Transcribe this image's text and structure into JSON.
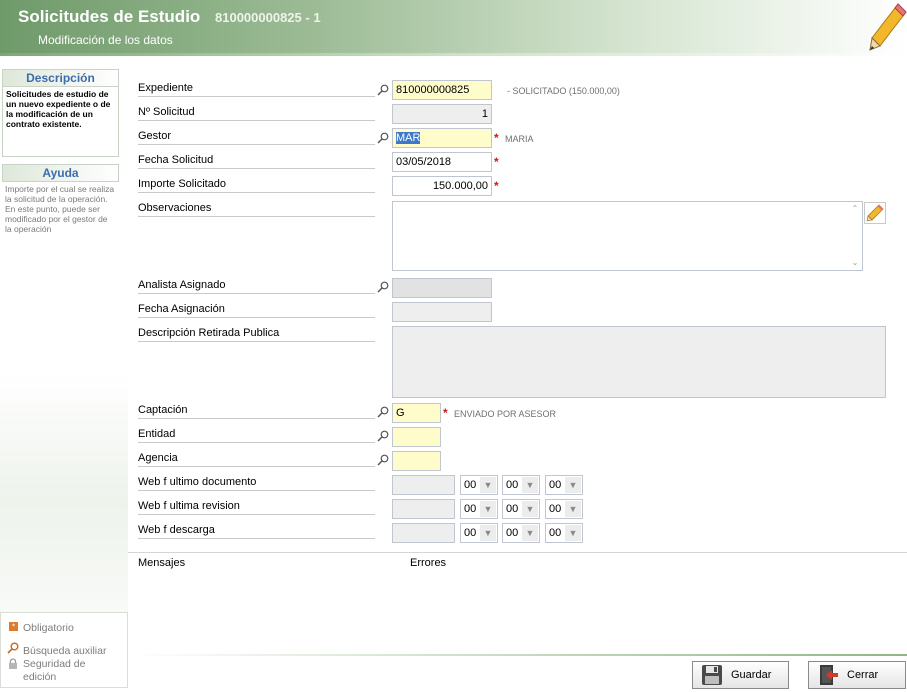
{
  "header": {
    "title": "Solicitudes de Estudio",
    "record_id": "810000000825 - 1",
    "subtitle": "Modificación de los datos"
  },
  "sidebar": {
    "description_title": "Descripción",
    "description_text": "Solicitudes de estudio de un nuevo expediente o de la modificación de un contrato existente.",
    "help_title": "Ayuda",
    "help_text": "Importe por el cual se realiza la solicitud de la operación. En este punto, puede ser modificado por el gestor de la operación"
  },
  "legend": {
    "required": "Obligatorio",
    "aux_search": "Búsqueda auxiliar",
    "edit_security": "Seguridad de edición"
  },
  "form": {
    "expediente": {
      "label": "Expediente",
      "value": "810000000825",
      "hint": "- SOLICITADO (150.000,00)"
    },
    "solicitud": {
      "label": "Nº Solicitud",
      "value": "1"
    },
    "gestor": {
      "label": "Gestor",
      "value": "MAR",
      "hint": "MARIA"
    },
    "fecha_solicitud": {
      "label": "Fecha Solicitud",
      "value": "03/05/2018"
    },
    "importe": {
      "label": "Importe Solicitado",
      "value": "150.000,00"
    },
    "observaciones": {
      "label": "Observaciones",
      "value": ""
    },
    "analista": {
      "label": "Analista Asignado",
      "value": ""
    },
    "fecha_asignacion": {
      "label": "Fecha Asignación",
      "value": ""
    },
    "descripcion_retirada": {
      "label": "Descripción Retirada Publica",
      "value": ""
    },
    "captacion": {
      "label": "Captación",
      "value": "G",
      "hint": "ENVIADO POR ASESOR"
    },
    "entidad": {
      "label": "Entidad",
      "value": ""
    },
    "agencia": {
      "label": "Agencia",
      "value": ""
    },
    "web_ultimo_doc": {
      "label": "Web f ultimo documento",
      "h": "00",
      "m": "00",
      "s": "00"
    },
    "web_ultima_rev": {
      "label": "Web f ultima revision",
      "h": "00",
      "m": "00",
      "s": "00"
    },
    "web_descarga": {
      "label": "Web f descarga",
      "h": "00",
      "m": "00",
      "s": "00"
    },
    "required_mark": "*"
  },
  "messages": {
    "mensajes": "Mensajes",
    "errores": "Errores"
  },
  "buttons": {
    "guardar": "Guardar",
    "cerrar": "Cerrar"
  },
  "colors": {
    "accent": "#6f9a6a",
    "required": "#c21f1f",
    "required_field_bg": "#fffccc",
    "readonly_bg": "#eeeeee"
  }
}
